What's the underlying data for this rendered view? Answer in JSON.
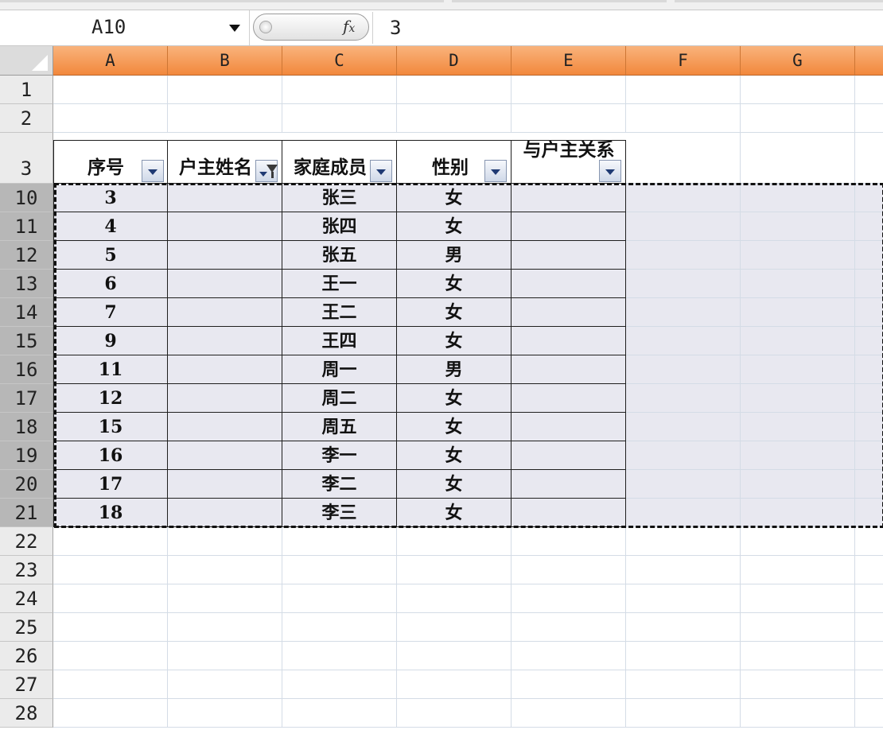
{
  "formula_bar": {
    "name_box": "A10",
    "fx_icon": "fx-function-icon",
    "formula_value": "3"
  },
  "columns": [
    "A",
    "B",
    "C",
    "D",
    "E",
    "F",
    "G"
  ],
  "top_rows": [
    "1",
    "2"
  ],
  "header_row": {
    "row_number": "3",
    "labels": [
      "序号",
      "户主姓名",
      "家庭成员",
      "性别",
      "与户主关系"
    ],
    "filter_icons": [
      "dropdown-arrow-icon",
      "filter-active-icon",
      "dropdown-arrow-icon",
      "dropdown-arrow-icon",
      "dropdown-arrow-icon"
    ]
  },
  "data_rows": [
    {
      "row": "10",
      "seq": "3",
      "owner": "",
      "member": "张三",
      "gender": "女",
      "relation": ""
    },
    {
      "row": "11",
      "seq": "4",
      "owner": "",
      "member": "张四",
      "gender": "女",
      "relation": ""
    },
    {
      "row": "12",
      "seq": "5",
      "owner": "",
      "member": "张五",
      "gender": "男",
      "relation": ""
    },
    {
      "row": "13",
      "seq": "6",
      "owner": "",
      "member": "王一",
      "gender": "女",
      "relation": ""
    },
    {
      "row": "14",
      "seq": "7",
      "owner": "",
      "member": "王二",
      "gender": "女",
      "relation": ""
    },
    {
      "row": "15",
      "seq": "9",
      "owner": "",
      "member": "王四",
      "gender": "女",
      "relation": ""
    },
    {
      "row": "16",
      "seq": "11",
      "owner": "",
      "member": "周一",
      "gender": "男",
      "relation": ""
    },
    {
      "row": "17",
      "seq": "12",
      "owner": "",
      "member": "周二",
      "gender": "女",
      "relation": ""
    },
    {
      "row": "18",
      "seq": "15",
      "owner": "",
      "member": "周五",
      "gender": "女",
      "relation": ""
    },
    {
      "row": "19",
      "seq": "16",
      "owner": "",
      "member": "李一",
      "gender": "女",
      "relation": ""
    },
    {
      "row": "20",
      "seq": "17",
      "owner": "",
      "member": "李二",
      "gender": "女",
      "relation": ""
    },
    {
      "row": "21",
      "seq": "18",
      "owner": "",
      "member": "李三",
      "gender": "女",
      "relation": ""
    }
  ],
  "bottom_rows": [
    "22",
    "23",
    "24",
    "25",
    "26",
    "27",
    "28"
  ],
  "colors": {
    "column_header": "#f2883c",
    "selected_row_header": "#b7b7b7",
    "selection_fill": "#e8e8f0"
  }
}
